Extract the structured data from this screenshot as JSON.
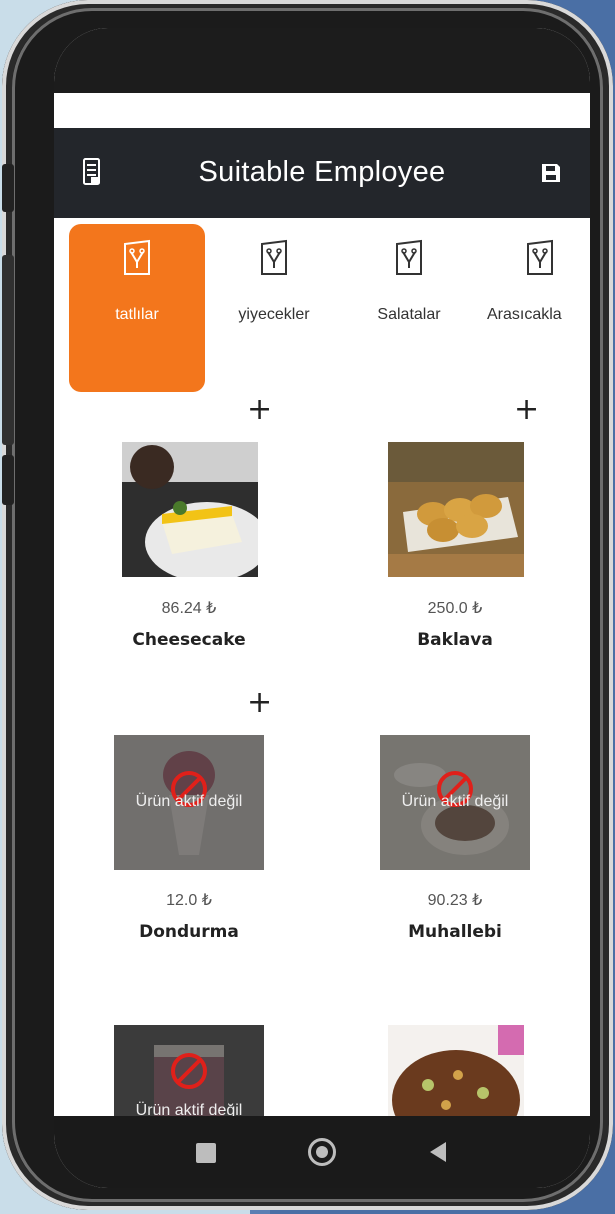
{
  "header": {
    "title": "Suitable Employee"
  },
  "categories": [
    {
      "label": "tatlılar",
      "active": true
    },
    {
      "label": "yiyecekler",
      "active": false
    },
    {
      "label": "Salatalar",
      "active": false
    },
    {
      "label": "Arasıcakla",
      "active": false
    }
  ],
  "products": [
    {
      "name": "Cheesecake",
      "price": "86.24 ₺"
    },
    {
      "name": "Baklava",
      "price": "250.0 ₺"
    },
    {
      "name": "Dondurma",
      "price": "12.0 ₺",
      "inactive_label": "Ürün aktif değil"
    },
    {
      "name": "Muhallebi",
      "price": "90.23 ₺",
      "inactive_label": "Ürün aktif değil"
    },
    {
      "inactive_label": "Ürün aktif değil"
    },
    {}
  ],
  "colors": {
    "accent": "#f3761c",
    "topbar": "#23262b",
    "inactive_icon": "#e0201a"
  },
  "icons": {
    "topbar_left": "receipt-list-icon",
    "topbar_right": "save-icon",
    "category": "menu-card-icon",
    "add": "plus-icon",
    "inactive": "blocked-icon",
    "nav": [
      "square-icon",
      "circle-icon",
      "back-triangle-icon"
    ]
  }
}
